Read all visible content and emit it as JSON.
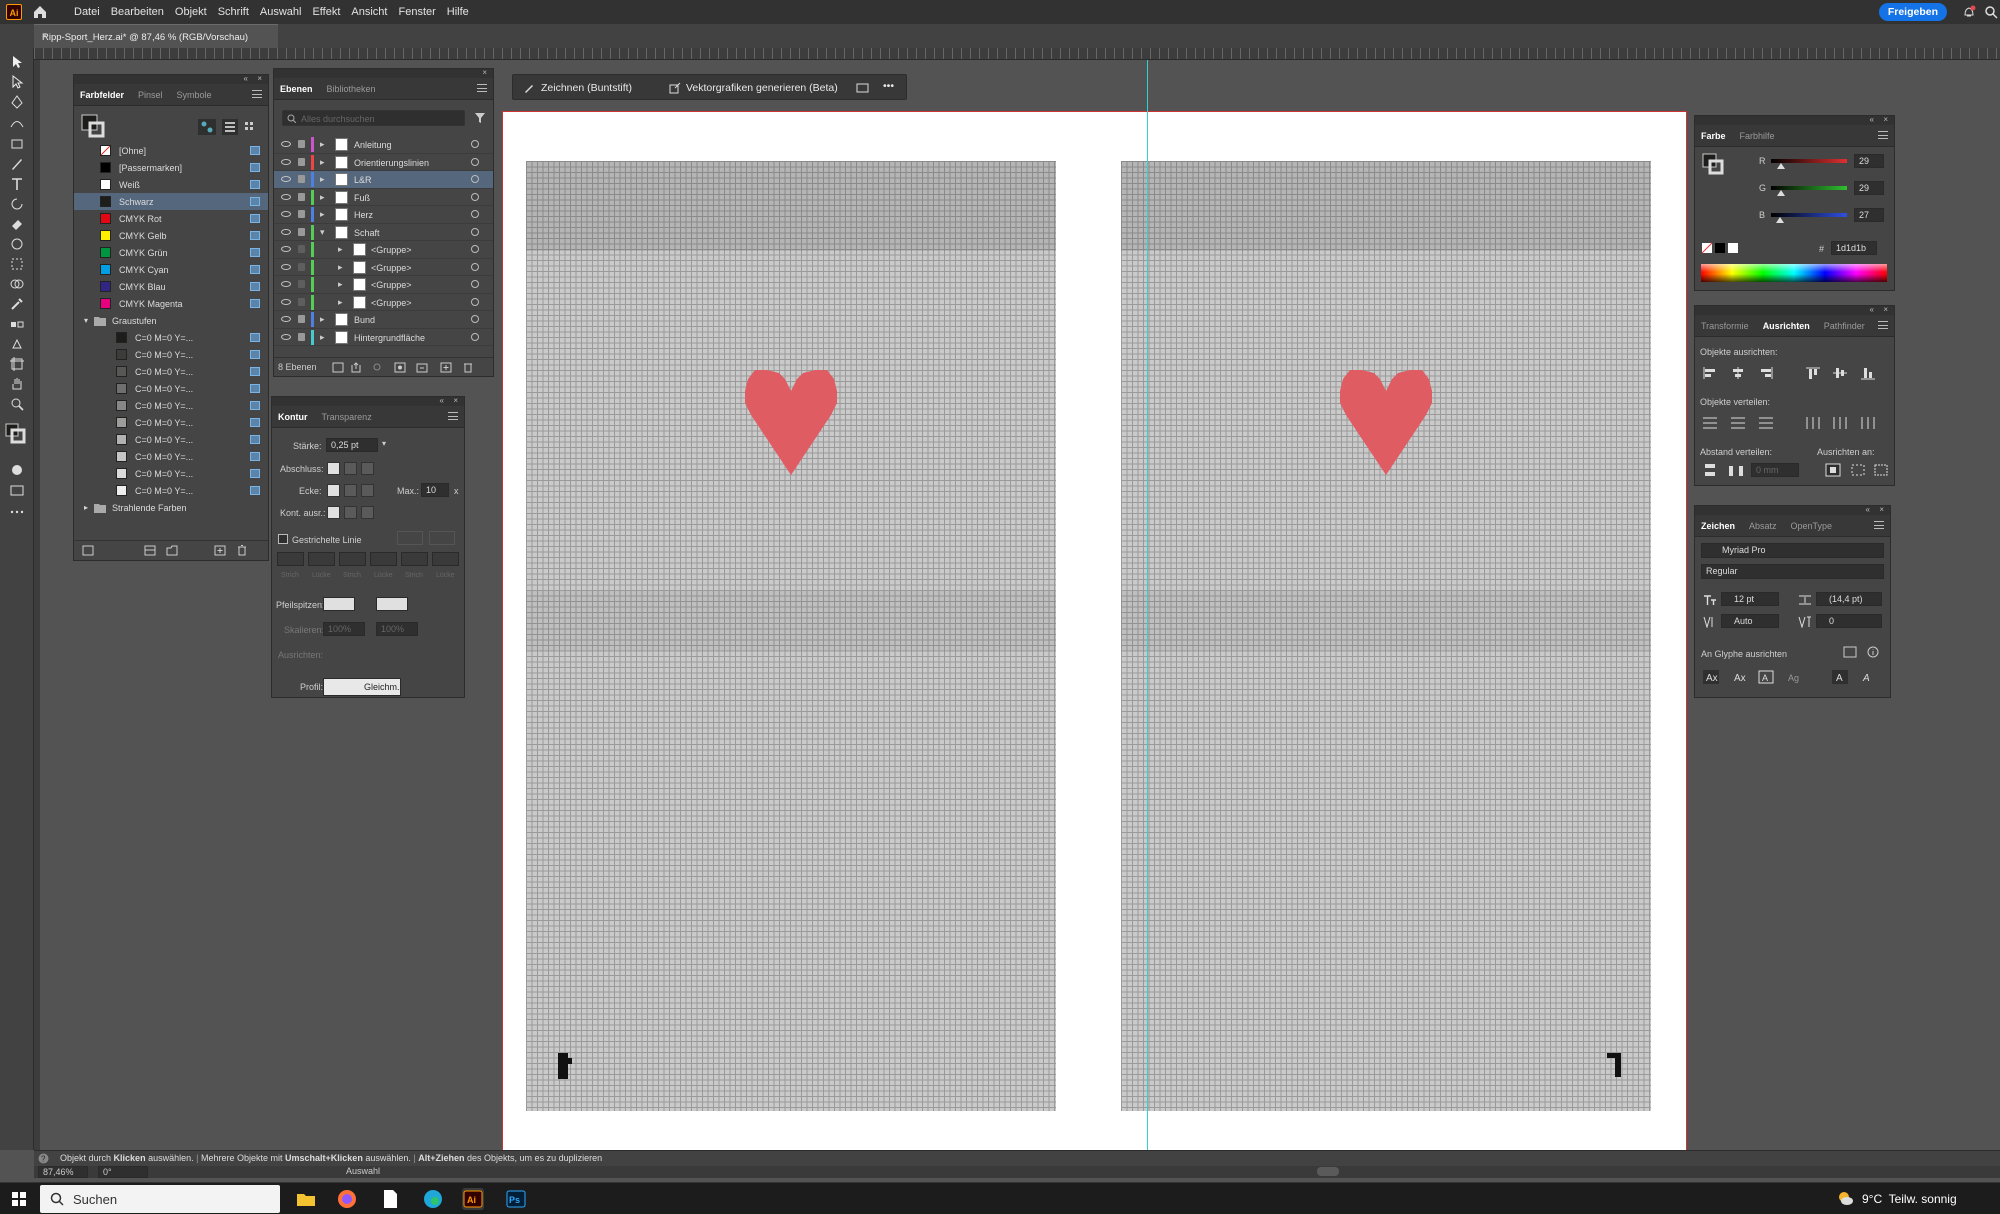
{
  "app": {
    "logo": "Ai",
    "share_label": "Freigeben",
    "menus": [
      "Datei",
      "Bearbeiten",
      "Objekt",
      "Schrift",
      "Auswahl",
      "Effekt",
      "Ansicht",
      "Fenster",
      "Hilfe"
    ]
  },
  "document": {
    "tab_title": "Ripp-Sport_Herz.ai* @ 87,46 % (RGB/Vorschau)",
    "close": "×"
  },
  "context_bar": {
    "draw": "Zeichnen (Buntstift)",
    "generate": "Vektorgrafiken generieren (Beta)",
    "more": "•••"
  },
  "swatches": {
    "tabs": [
      "Farbfelder",
      "Pinsel",
      "Symbole"
    ],
    "items": [
      {
        "name": "[Ohne]",
        "color": "#ffffff"
      },
      {
        "name": "[Passermarken]",
        "color": "#000000"
      },
      {
        "name": "Weiß",
        "color": "#ffffff"
      },
      {
        "name": "Schwarz",
        "color": "#1d1d1b"
      },
      {
        "name": "CMYK Rot",
        "color": "#e30613"
      },
      {
        "name": "CMYK Gelb",
        "color": "#ffed00"
      },
      {
        "name": "CMYK Grün",
        "color": "#009640"
      },
      {
        "name": "CMYK Cyan",
        "color": "#009fe3"
      },
      {
        "name": "CMYK Blau",
        "color": "#312783"
      },
      {
        "name": "CMYK Magenta",
        "color": "#e6007e"
      }
    ],
    "group_name": "Graustufen",
    "gray_items": [
      {
        "name": "C=0 M=0 Y=...",
        "color": "#1d1d1b"
      },
      {
        "name": "C=0 M=0 Y=...",
        "color": "#3c3c3b"
      },
      {
        "name": "C=0 M=0 Y=...",
        "color": "#575756"
      },
      {
        "name": "C=0 M=0 Y=...",
        "color": "#706f6f"
      },
      {
        "name": "C=0 M=0 Y=...",
        "color": "#878787"
      },
      {
        "name": "C=0 M=0 Y=...",
        "color": "#9d9d9c"
      },
      {
        "name": "C=0 M=0 Y=...",
        "color": "#b2b2b2"
      },
      {
        "name": "C=0 M=0 Y=...",
        "color": "#c6c6c6"
      },
      {
        "name": "C=0 M=0 Y=...",
        "color": "#dadada"
      },
      {
        "name": "C=0 M=0 Y=...",
        "color": "#ededed"
      }
    ],
    "folder": "Strahlende Farben"
  },
  "layers": {
    "tabs": [
      "Ebenen",
      "Bibliotheken"
    ],
    "search_placeholder": "Alles durchsuchen",
    "items": [
      {
        "name": "Anleitung",
        "color": "#cc55cc"
      },
      {
        "name": "Orientierungslinien",
        "color": "#ee4444"
      },
      {
        "name": "L&R",
        "color": "#4f7fe0"
      },
      {
        "name": "Fuß",
        "color": "#55cc55"
      },
      {
        "name": "Herz",
        "color": "#4f7fe0"
      },
      {
        "name": "Schaft",
        "color": "#55cc55"
      },
      {
        "name": "<Gruppe>",
        "color": "#55cc55"
      },
      {
        "name": "<Gruppe>",
        "color": "#55cc55"
      },
      {
        "name": "<Gruppe>",
        "color": "#55cc55"
      },
      {
        "name": "<Gruppe>",
        "color": "#55cc55"
      },
      {
        "name": "Bund",
        "color": "#4f7fe0"
      },
      {
        "name": "Hintergrundfläche",
        "color": "#44cccc"
      }
    ],
    "count": "8 Ebenen"
  },
  "stroke": {
    "tabs": [
      "Kontur",
      "Transparenz"
    ],
    "weight_label": "Stärke:",
    "weight": "0,25 pt",
    "cap_label": "Abschluss:",
    "corner_label": "Ecke:",
    "limit_label": "Max.:",
    "limit": "10",
    "limit_unit": "x",
    "align_label": "Kont. ausr.:",
    "dashed_label": "Gestrichelte Linie",
    "dash_labels": [
      "Strich",
      "Lücke",
      "Strich",
      "Lücke",
      "Strich",
      "Lücke"
    ],
    "arrows_label": "Pfeilspitzen:",
    "scale_label": "Skalieren:",
    "scale_a": "100%",
    "scale_b": "100%",
    "align2_label": "Ausrichten:",
    "profile_label": "Profil:",
    "profile": "Gleichm."
  },
  "color": {
    "tabs": [
      "Farbe",
      "Farbhilfe"
    ],
    "channels": [
      {
        "label": "R",
        "value": "29",
        "color": "#e03030"
      },
      {
        "label": "G",
        "value": "29",
        "color": "#30c030"
      },
      {
        "label": "B",
        "value": "27",
        "color": "#3050e0"
      }
    ],
    "hex_label": "#",
    "hex": "1d1d1b"
  },
  "align": {
    "tabs": [
      "Transformie",
      "Ausrichten",
      "Pathfinder"
    ],
    "objects_label": "Objekte ausrichten:",
    "distribute_label": "Objekte verteilen:",
    "spacing_label": "Abstand verteilen:",
    "to_label": "Ausrichten an:",
    "spacing": "0 mm"
  },
  "character": {
    "tabs": [
      "Zeichen",
      "Absatz",
      "OpenType"
    ],
    "font": "Myriad Pro",
    "style": "Regular",
    "size": "12 pt",
    "leading": "(14,4 pt)",
    "kerning": "Auto",
    "tracking": "0",
    "glyph_label": "An Glyphe ausrichten"
  },
  "status": {
    "hint_prefix": "Objekt durch",
    "hint_click": "Klicken",
    "hint_mid": "auswählen.",
    "hint_multi_pre": "Mehrere Objekte mit",
    "hint_multi": "Umschalt+Klicken",
    "hint_multi_post": "auswählen.",
    "hint_alt": "Alt+Ziehen",
    "hint_alt_post": "des Objekts, um es zu duplizieren"
  },
  "bottom": {
    "zoom": "87,46%",
    "angle": "0°",
    "mode": "Auswahl"
  },
  "taskbar": {
    "search": "Suchen",
    "weather": "9°C  Teilw. sonnig"
  },
  "heart_color": "#e05c63"
}
